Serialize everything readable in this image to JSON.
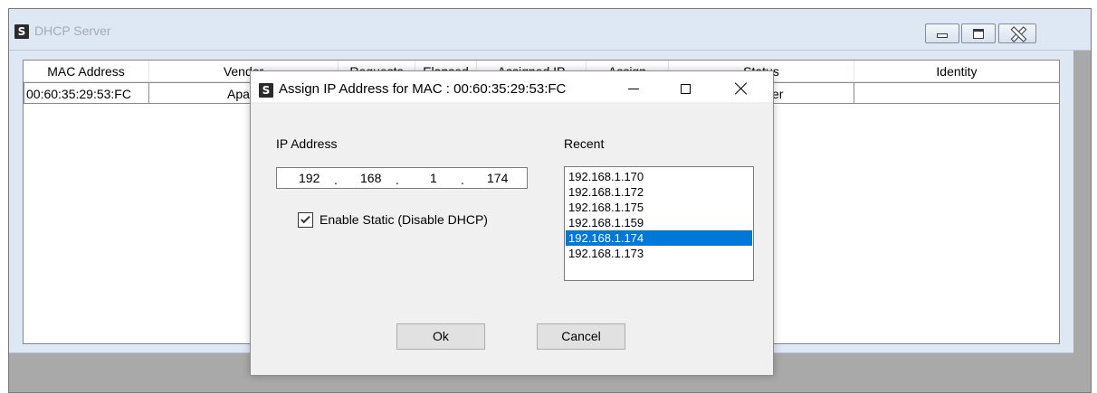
{
  "main_window": {
    "title": "DHCP Server",
    "icon": "s-app-icon"
  },
  "listview": {
    "columns": [
      "MAC Address",
      "Vendor",
      "Requests",
      "Elapsed",
      "Assigned IP",
      "Assign",
      "Status",
      "Identity"
    ],
    "rows": [
      {
        "mac": "00:60:35:29:53:FC",
        "vendor": "Apar",
        "status": "ver",
        "identity": ""
      }
    ]
  },
  "dialog": {
    "title": "Assign IP Address for MAC : 00:60:35:29:53:FC",
    "icon": "s-app-icon",
    "ip_label": "IP Address",
    "ip": {
      "o1": "192",
      "o2": "168",
      "o3": "1",
      "o4": "174",
      "sep": "."
    },
    "static_checkbox": {
      "label": "Enable Static (Disable DHCP)",
      "checked": true
    },
    "recent_label": "Recent",
    "recent": [
      "192.168.1.170",
      "192.168.1.172",
      "192.168.1.175",
      "192.168.1.159",
      "192.168.1.174",
      "192.168.1.173"
    ],
    "recent_selected": "192.168.1.174",
    "ok_label": "Ok",
    "cancel_label": "Cancel"
  },
  "colors": {
    "selection": "#0078d7",
    "titlebar": "#dde8f4",
    "background": "#a9a9a9"
  }
}
